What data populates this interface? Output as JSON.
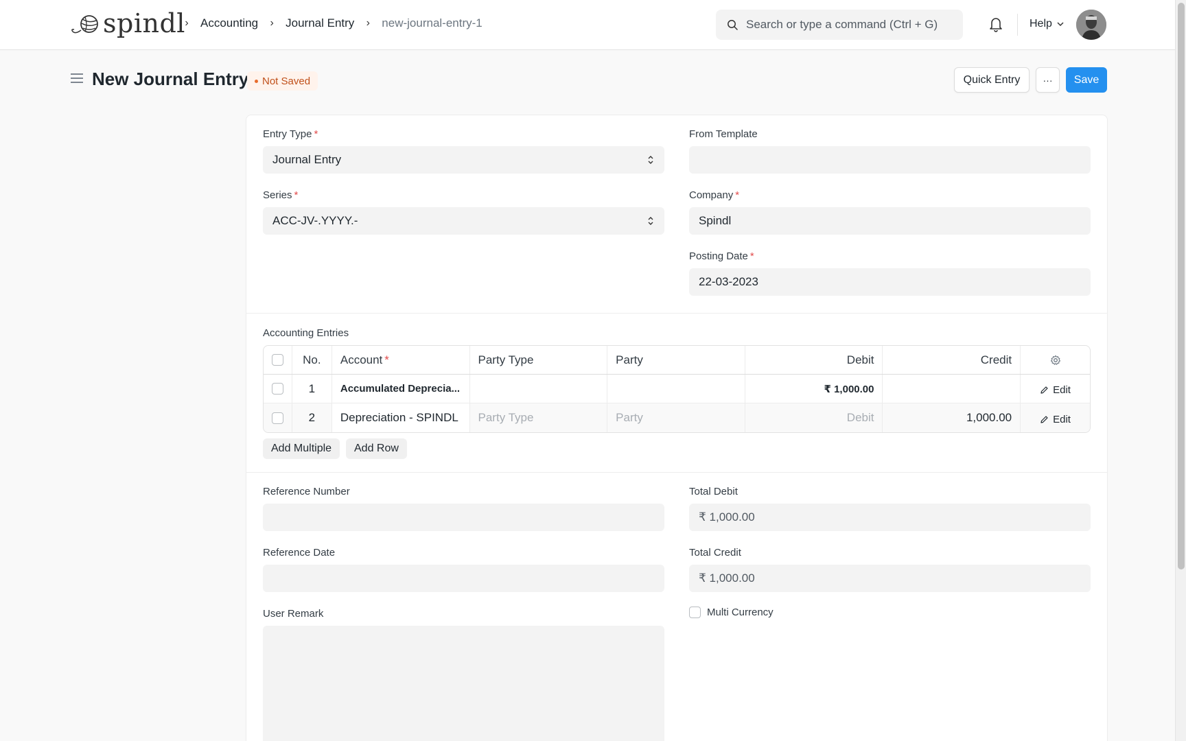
{
  "navbar": {
    "logo_text": "spindl",
    "breadcrumbs": [
      "Accounting",
      "Journal Entry",
      "new-journal-entry-1"
    ],
    "search_placeholder": "Search or type a command (Ctrl + G)",
    "help_label": "Help"
  },
  "page": {
    "title": "New Journal Entry",
    "status": "Not Saved",
    "quick_entry_label": "Quick Entry",
    "more_label": "···",
    "save_label": "Save"
  },
  "form": {
    "entry_type": {
      "label": "Entry Type",
      "value": "Journal Entry"
    },
    "from_template": {
      "label": "From Template",
      "value": ""
    },
    "series": {
      "label": "Series",
      "value": "ACC-JV-.YYYY.-"
    },
    "company": {
      "label": "Company",
      "value": "Spindl"
    },
    "posting_date": {
      "label": "Posting Date",
      "value": "22-03-2023"
    }
  },
  "accounting_entries": {
    "section_label": "Accounting Entries",
    "columns": [
      "No.",
      "Account",
      "Party Type",
      "Party",
      "Debit",
      "Credit"
    ],
    "rows": [
      {
        "no": "1",
        "account": "Accumulated Deprecia...",
        "party_type": "",
        "party": "",
        "debit": "₹ 1,000.00",
        "credit": "",
        "edit": "Edit"
      },
      {
        "no": "2",
        "account": "Depreciation - SPINDL",
        "party_type": "Party Type",
        "party": "Party",
        "debit": "Debit",
        "credit": "1,000.00",
        "edit": "Edit"
      }
    ],
    "add_multiple_label": "Add Multiple",
    "add_row_label": "Add Row"
  },
  "references": {
    "reference_number": {
      "label": "Reference Number",
      "value": ""
    },
    "reference_date": {
      "label": "Reference Date",
      "value": ""
    },
    "user_remark": {
      "label": "User Remark",
      "value": ""
    }
  },
  "totals": {
    "total_debit": {
      "label": "Total Debit",
      "value": "₹ 1,000.00"
    },
    "total_credit": {
      "label": "Total Credit",
      "value": "₹ 1,000.00"
    },
    "multi_currency_label": "Multi Currency"
  },
  "colors": {
    "primary": "#2490ef",
    "status_bg": "#fff3ec",
    "status_text": "#c0501a",
    "required": "#e24c4c"
  },
  "icons": [
    "yarn-logo-icon",
    "chevron-right-icon",
    "search-icon",
    "bell-icon",
    "chevron-down-icon",
    "hamburger-icon",
    "select-arrows-icon",
    "gear-icon",
    "pencil-icon"
  ]
}
